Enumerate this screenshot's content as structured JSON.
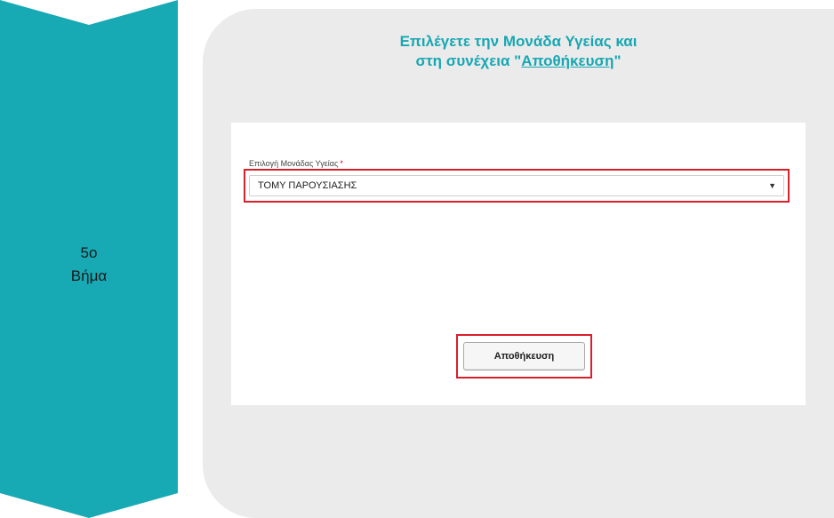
{
  "step": {
    "number": "5ο",
    "word": "Βήμα",
    "color": "#17a9b4"
  },
  "instructions": {
    "line1": "Επιλέγετε την Μονάδα Υγείας και",
    "line2_prefix": "στη συνέχεια \"",
    "line2_link": "Αποθήκευση",
    "line2_suffix": "\"",
    "color": "#17a7b3"
  },
  "form": {
    "label": "Επιλογή Μονάδας Υγείας",
    "required_mark": "*",
    "selected_value": "ΤΟΜΥ ΠΑΡΟΥΣΙΑΣΗΣ",
    "caret": "▼",
    "save_label": "Αποθήκευση"
  },
  "highlight_color": "#d9202a"
}
